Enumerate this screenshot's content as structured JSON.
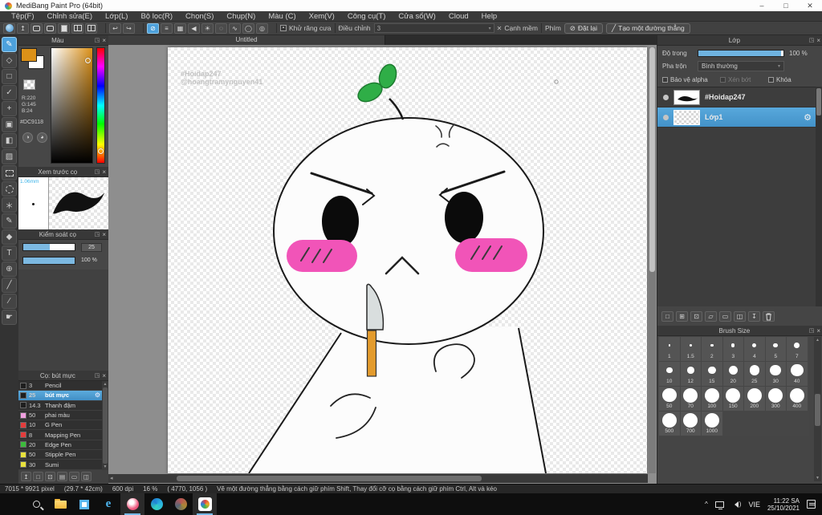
{
  "window": {
    "title": "MediBang Paint Pro (64bit)",
    "minimize": "–",
    "maximize": "□",
    "close": "✕"
  },
  "menu": {
    "items": [
      "Tệp(F)",
      "Chỉnh sửa(E)",
      "Lớp(L)",
      "Bộ lọc(R)",
      "Chọn(S)",
      "Chụp(N)",
      "Màu (C)",
      "Xem(V)",
      "Công cụ(T)",
      "Cửa sổ(W)",
      "Cloud",
      "Help"
    ]
  },
  "toolbar": {
    "undo_glyph": "↩",
    "redo_glyph": "↪",
    "snap_tools": [
      {
        "name": "snap-off",
        "glyph": "⊘",
        "selected": true
      },
      {
        "name": "snap-parallel",
        "glyph": "≡",
        "selected": false
      },
      {
        "name": "snap-cross",
        "glyph": "▦",
        "selected": false
      },
      {
        "name": "snap-vanishing",
        "glyph": "◀",
        "selected": false
      },
      {
        "name": "snap-radial",
        "glyph": "☀",
        "selected": false
      },
      {
        "name": "snap-circle",
        "glyph": "◌",
        "selected": false
      },
      {
        "name": "snap-curve",
        "glyph": "∿",
        "selected": false
      },
      {
        "name": "snap-ellipse",
        "glyph": "◯",
        "selected": false
      },
      {
        "name": "snap-concentric",
        "glyph": "◎",
        "selected": false
      }
    ],
    "antialias_label": "Khử răng cưa",
    "correction_label": "Điều chỉnh",
    "correction_value": "3",
    "soft_edge_label": "Cạnh mềm",
    "key_label": "Phím",
    "reset_label": "Đặt lại",
    "reset_glyph": "⊘",
    "line_label": "Tạo một đường thẳng",
    "line_glyph": "╱"
  },
  "tools": [
    {
      "name": "brush-tool",
      "glyph": "✎",
      "selected": true
    },
    {
      "name": "eraser-tool",
      "glyph": "◇",
      "selected": false
    },
    {
      "name": "shape-brush-tool",
      "glyph": "□",
      "selected": false
    },
    {
      "name": "snap-tool",
      "glyph": "✓",
      "selected": false
    },
    {
      "name": "move-tool",
      "glyph": "+",
      "selected": false
    },
    {
      "name": "fill-rect-tool",
      "glyph": "▣",
      "selected": false
    },
    {
      "name": "bucket-tool",
      "glyph": "◧",
      "selected": false
    },
    {
      "name": "gradient-tool",
      "glyph": "▨",
      "selected": false
    },
    {
      "name": "select-rect-tool",
      "shape": "dash-rect",
      "selected": false
    },
    {
      "name": "lasso-tool",
      "shape": "dash-circ",
      "selected": false
    },
    {
      "name": "magic-wand-tool",
      "glyph": "＊",
      "selected": false
    },
    {
      "name": "select-pen-tool",
      "glyph": "✎",
      "selected": false
    },
    {
      "name": "select-eraser-tool",
      "glyph": "◆",
      "selected": false
    },
    {
      "name": "text-tool",
      "glyph": "T",
      "selected": false
    },
    {
      "name": "operation-tool",
      "glyph": "⊕",
      "selected": false
    },
    {
      "name": "eyedropper-tool",
      "glyph": "╱",
      "selected": false
    },
    {
      "name": "pen-tool",
      "glyph": "∕",
      "selected": false
    },
    {
      "name": "hand-tool",
      "glyph": "☛",
      "selected": false
    }
  ],
  "color_panel": {
    "title": "Màu",
    "r": "R:220",
    "g": "G:145",
    "b": "B:24",
    "hex": "#DC9118",
    "fg_color": "#DC9118"
  },
  "preview_panel": {
    "title": "Xem trước cọ",
    "size_label": "1.06mm"
  },
  "control_panel": {
    "title": "Kiểm soát cọ",
    "size_value": "25",
    "opacity_value": "100 %"
  },
  "brush_panel": {
    "title": "Cọ: bút mực",
    "brushes": [
      {
        "size": "3",
        "name": "Pencil",
        "color": "#1e1e1e",
        "selected": false
      },
      {
        "size": "25",
        "name": "bút mực",
        "color": "#1e1e1e",
        "selected": true
      },
      {
        "size": "14.3",
        "name": "Thanh đậm",
        "color": "#1e1e1e",
        "selected": false
      },
      {
        "size": "50",
        "name": "phai màu",
        "color": "#f0a0e0",
        "selected": false
      },
      {
        "size": "10",
        "name": "G Pen",
        "color": "#e43c3c",
        "selected": false
      },
      {
        "size": "8",
        "name": "Mapping Pen",
        "color": "#e43c3c",
        "selected": false
      },
      {
        "size": "20",
        "name": "Edge Pen",
        "color": "#3cbc3c",
        "selected": false
      },
      {
        "size": "50",
        "name": "Stipple Pen",
        "color": "#e8e23c",
        "selected": false
      },
      {
        "size": "30",
        "name": "Sumi",
        "color": "#e8e23c",
        "selected": false
      }
    ],
    "toolbar_icons": [
      {
        "name": "upload-brush-icon",
        "glyph": "↥"
      },
      {
        "name": "new-brush-icon",
        "glyph": "□"
      },
      {
        "name": "add-brush-menu-icon",
        "glyph": "⊡"
      },
      {
        "name": "edit-brush-icon",
        "glyph": "▤"
      },
      {
        "name": "brush-folder-icon",
        "glyph": "▭"
      },
      {
        "name": "duplicate-brush-icon",
        "glyph": "◫"
      }
    ]
  },
  "tab": {
    "label": "Untitled"
  },
  "canvas": {
    "watermark1": "#Hoidap247",
    "watermark2": "@hoangtramynguyen41"
  },
  "layers_panel": {
    "title": "Lớp",
    "opacity_label": "Độ trong",
    "opacity_value": "100 %",
    "blend_label": "Pha trộn",
    "blend_value": "Bình thường",
    "check_alpha": "Bảo vệ alpha",
    "check_clip": "Xén bớt",
    "check_lock": "Khóa",
    "layers": [
      {
        "name": "#Hoidap247",
        "thumb": "stroke",
        "selected": false
      },
      {
        "name": "Lớp1",
        "thumb": "checker",
        "selected": true
      }
    ],
    "toolbar_icons": [
      {
        "name": "new-layer-icon",
        "glyph": "□"
      },
      {
        "name": "duplicate-layer-icon",
        "glyph": "⊞"
      },
      {
        "name": "new-1bit-layer-icon",
        "glyph": "⊡"
      },
      {
        "name": "add-layer-menu-icon",
        "glyph": "▱"
      },
      {
        "name": "layer-folder-icon",
        "glyph": "▭"
      },
      {
        "name": "copy-layer-icon",
        "glyph": "◫"
      },
      {
        "name": "merge-layer-icon",
        "glyph": "↧"
      },
      {
        "name": "delete-layer-icon",
        "glyph": "trash"
      }
    ]
  },
  "brush_size_panel": {
    "title": "Brush Size",
    "sizes": [
      "1",
      "1.5",
      "2",
      "3",
      "4",
      "5",
      "7",
      "10",
      "12",
      "15",
      "20",
      "25",
      "30",
      "40",
      "50",
      "70",
      "100",
      "150",
      "200",
      "300",
      "400",
      "500",
      "700",
      "1000"
    ]
  },
  "status_bar": {
    "dimensions": "7015 * 9921 pixel",
    "size_cm": "(29.7 * 42cm)",
    "dpi": "600 dpi",
    "zoom": "16 %",
    "coords": "( 4770, 1056 )",
    "hint": "Vẽ một đường thẳng bằng cách giữ phím Shift, Thay đổi cỡ cọ bằng cách giữ phím Ctrl, Alt và kéo"
  },
  "taskbar": {
    "apps": [
      {
        "name": "start-button",
        "kind": "win",
        "active": false
      },
      {
        "name": "search-button",
        "kind": "magni",
        "active": false
      },
      {
        "name": "file-explorer-icon",
        "kind": "folder",
        "active": false
      },
      {
        "name": "store-icon",
        "kind": "storeic",
        "active": false
      },
      {
        "name": "internet-explorer-icon",
        "kind": "eic",
        "active": false
      },
      {
        "name": "browser-app-icon",
        "kind": "redapp",
        "active": true
      },
      {
        "name": "edge-icon",
        "kind": "edgeic",
        "active": false
      },
      {
        "name": "paint-app-icon",
        "kind": "p3dic",
        "active": false
      },
      {
        "name": "medibang-taskbar-icon",
        "kind": "mbtile",
        "active": true
      }
    ],
    "tray": {
      "language": "VIE",
      "time": "11:22 SA",
      "date": "25/10/2021"
    }
  },
  "ui": {
    "popout_glyph": "◳",
    "close_glyph": "×",
    "gear_glyph": "⚙",
    "dropdown_arrow": "▾",
    "accent_blue": "#4da1dc"
  }
}
